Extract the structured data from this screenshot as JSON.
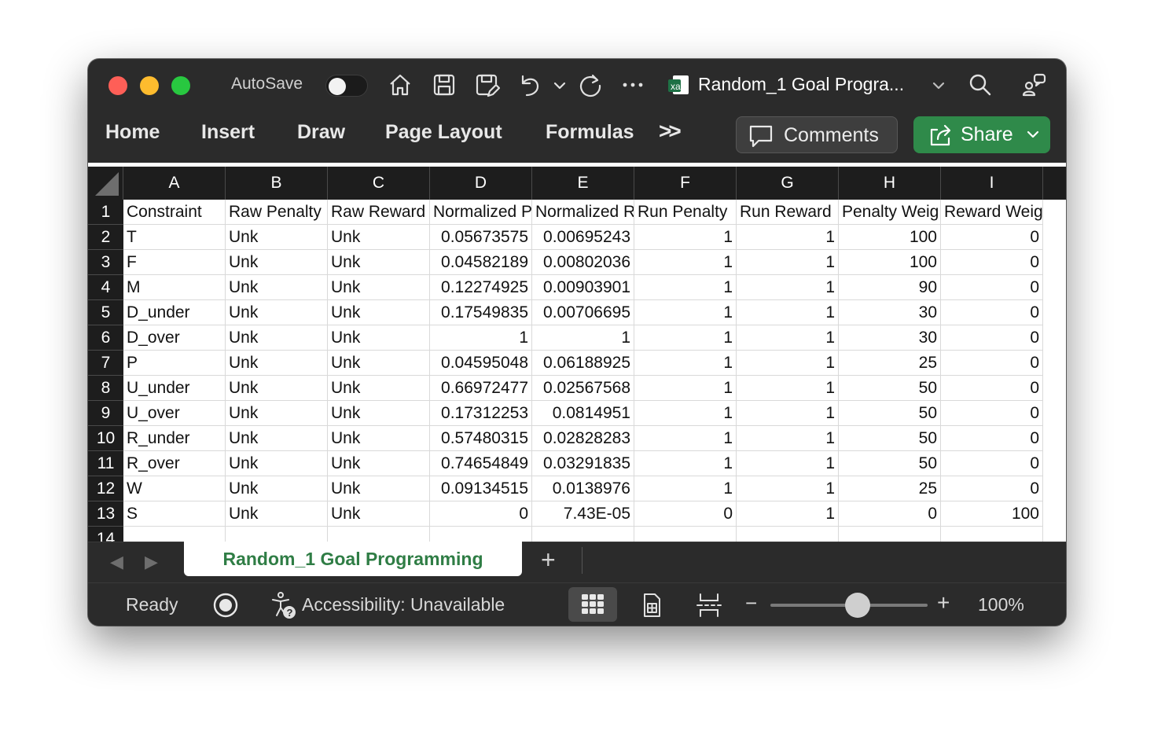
{
  "titlebar": {
    "autosave_label": "AutoSave",
    "autosave_on": false,
    "doc_title": "Random_1 Goal Progra..."
  },
  "ribbon": {
    "tabs": [
      "Home",
      "Insert",
      "Draw",
      "Page Layout",
      "Formulas"
    ],
    "more": ">>",
    "comments_label": "Comments",
    "share_label": "Share"
  },
  "grid": {
    "columns": [
      "A",
      "B",
      "C",
      "D",
      "E",
      "F",
      "G",
      "H",
      "I"
    ],
    "rows": [
      {
        "n": "1",
        "cells": [
          "Constraint",
          "Raw Penalty",
          "Raw Reward",
          "Normalized P",
          "Normalized R",
          "Run Penalty",
          "Run Reward",
          "Penalty Weig",
          "Reward Weight"
        ]
      },
      {
        "n": "2",
        "cells": [
          "T",
          "Unk",
          "Unk",
          "0.05673575",
          "0.00695243",
          "1",
          "1",
          "100",
          "0"
        ]
      },
      {
        "n": "3",
        "cells": [
          "F",
          "Unk",
          "Unk",
          "0.04582189",
          "0.00802036",
          "1",
          "1",
          "100",
          "0"
        ]
      },
      {
        "n": "4",
        "cells": [
          "M",
          "Unk",
          "Unk",
          "0.12274925",
          "0.00903901",
          "1",
          "1",
          "90",
          "0"
        ]
      },
      {
        "n": "5",
        "cells": [
          "D_under",
          "Unk",
          "Unk",
          "0.17549835",
          "0.00706695",
          "1",
          "1",
          "30",
          "0"
        ]
      },
      {
        "n": "6",
        "cells": [
          "D_over",
          "Unk",
          "Unk",
          "1",
          "1",
          "1",
          "1",
          "30",
          "0"
        ]
      },
      {
        "n": "7",
        "cells": [
          "P",
          "Unk",
          "Unk",
          "0.04595048",
          "0.06188925",
          "1",
          "1",
          "25",
          "0"
        ]
      },
      {
        "n": "8",
        "cells": [
          "U_under",
          "Unk",
          "Unk",
          "0.66972477",
          "0.02567568",
          "1",
          "1",
          "50",
          "0"
        ]
      },
      {
        "n": "9",
        "cells": [
          "U_over",
          "Unk",
          "Unk",
          "0.17312253",
          "0.0814951",
          "1",
          "1",
          "50",
          "0"
        ]
      },
      {
        "n": "10",
        "cells": [
          "R_under",
          "Unk",
          "Unk",
          "0.57480315",
          "0.02828283",
          "1",
          "1",
          "50",
          "0"
        ]
      },
      {
        "n": "11",
        "cells": [
          "R_over",
          "Unk",
          "Unk",
          "0.74654849",
          "0.03291835",
          "1",
          "1",
          "50",
          "0"
        ]
      },
      {
        "n": "12",
        "cells": [
          "W",
          "Unk",
          "Unk",
          "0.09134515",
          "0.0138976",
          "1",
          "1",
          "25",
          "0"
        ]
      },
      {
        "n": "13",
        "cells": [
          "S",
          "Unk",
          "Unk",
          "0",
          "7.43E-05",
          "0",
          "1",
          "0",
          "100"
        ]
      },
      {
        "n": "14",
        "cells": [
          "",
          "",
          "",
          "",
          "",
          "",
          "",
          "",
          ""
        ]
      }
    ]
  },
  "sheets": {
    "active_tab": "Random_1 Goal Programming",
    "add_label": "+"
  },
  "status": {
    "ready": "Ready",
    "accessibility": "Accessibility: Unavailable",
    "zoom_minus": "−",
    "zoom_plus": "+",
    "zoom_level": "100%",
    "zoom_fraction": 0.5
  },
  "icons": [
    "home-icon",
    "save-icon",
    "save-as-icon",
    "undo-icon",
    "redo-icon",
    "more-icon",
    "excel-file-icon",
    "search-icon",
    "share-people-icon",
    "comment-icon",
    "share-icon",
    "record-icon",
    "accessibility-icon",
    "normal-view-icon",
    "page-layout-view-icon",
    "page-break-view-icon"
  ],
  "colors": {
    "share_green": "#2f8a4a",
    "sheet_tab_text": "#2f7d45",
    "header_bg": "#1d1d1d",
    "window_bg": "#2b2b2b"
  }
}
